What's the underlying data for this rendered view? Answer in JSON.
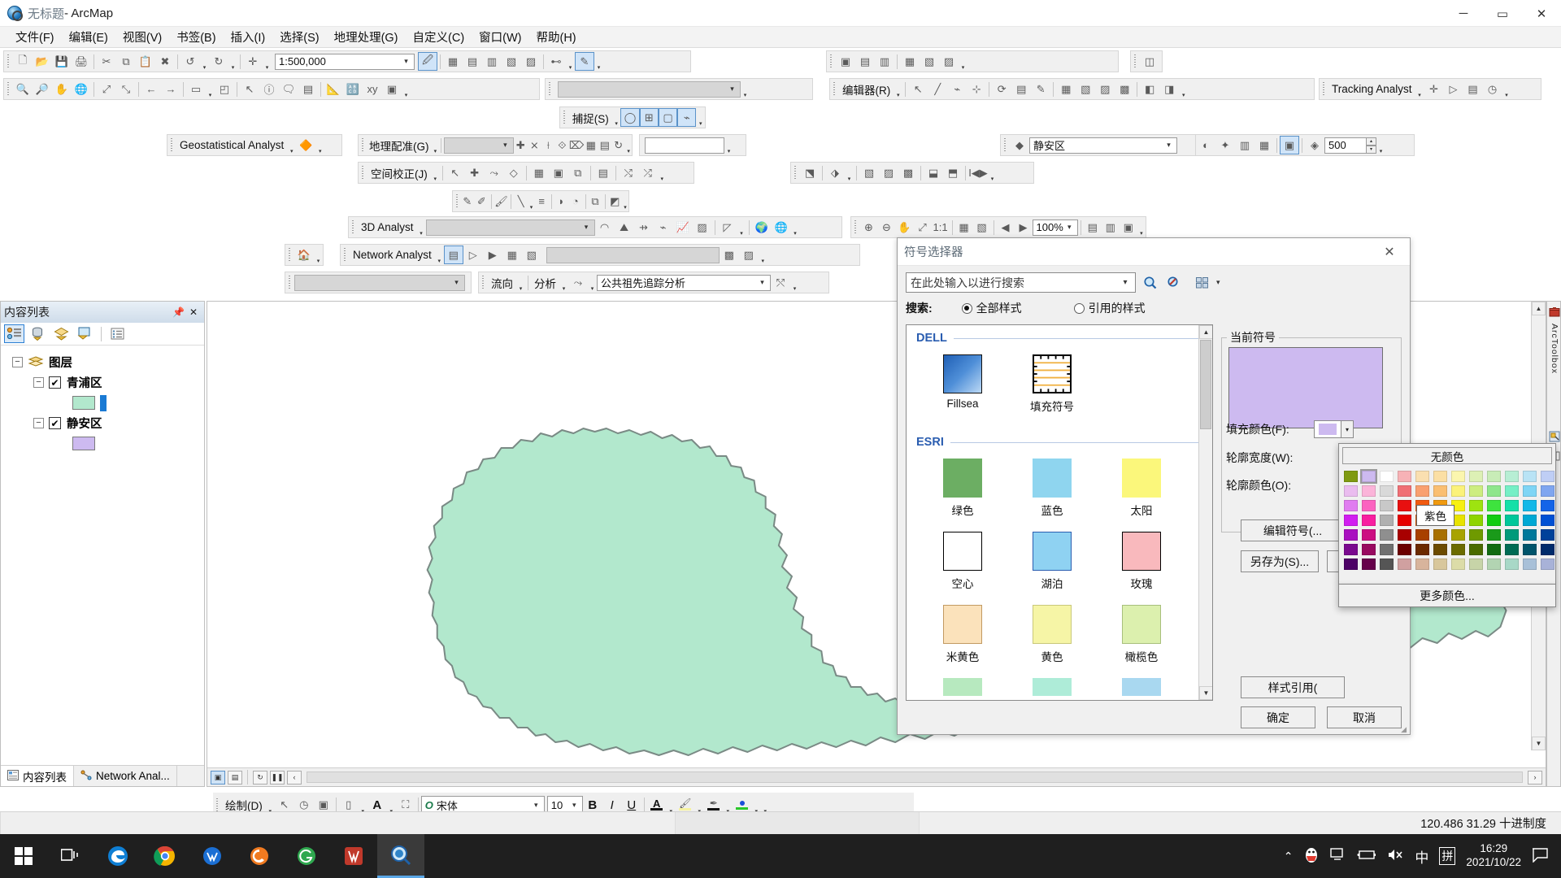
{
  "window": {
    "doc_title": "无标题",
    "app_title": " - ArcMap",
    "minimize": "─",
    "maximize": "▭",
    "close": "✕"
  },
  "menu": [
    {
      "label": "文件(F)"
    },
    {
      "label": "编辑(E)"
    },
    {
      "label": "视图(V)"
    },
    {
      "label": "书签(B)"
    },
    {
      "label": "插入(I)"
    },
    {
      "label": "选择(S)"
    },
    {
      "label": "地理处理(G)"
    },
    {
      "label": "自定义(C)"
    },
    {
      "label": "窗口(W)"
    },
    {
      "label": "帮助(H)"
    }
  ],
  "toolbars": {
    "standard": {
      "scale_value": "1:500,000"
    },
    "snapping": {
      "label": "捕捉(S)"
    },
    "editor": {
      "label": "编辑器(R)"
    },
    "tracking": {
      "label": "Tracking Analyst"
    },
    "geostat": {
      "label": "Geostatistical Analyst"
    },
    "georef": {
      "label": "地理配准(G)",
      "combo_value": ""
    },
    "spatial_adjust": {
      "label": "空间校正(J)"
    },
    "analyst3d": {
      "label": "3D Analyst",
      "combo_value": ""
    },
    "network": {
      "label": "Network Analyst",
      "combo_value": ""
    },
    "utility": {
      "flow": "流向",
      "analysis": "分析",
      "trace_value": "公共祖先追踪分析"
    },
    "layer_select": {
      "value": "静安区"
    },
    "buffer_value": "500",
    "zoom_pct": "100%",
    "draw": {
      "label": "绘制(D)",
      "font": "宋体",
      "size": "10",
      "bold": "B",
      "italic": "I",
      "underline": "U"
    }
  },
  "toc": {
    "title": "内容列表",
    "pin": "📌",
    "close": "✕",
    "root": "图层",
    "layers": [
      {
        "name": "青浦区",
        "fill": "#b2e8cd",
        "checked": true
      },
      {
        "name": "静安区",
        "fill": "#cdbaf0",
        "checked": true
      }
    ],
    "tabs": [
      {
        "label": "内容列表",
        "active": true
      },
      {
        "label": "Network Anal...",
        "active": false
      }
    ]
  },
  "right_dock": [
    {
      "label": "ArcToolbox"
    },
    {
      "label": ""
    }
  ],
  "dialog": {
    "title": "符号选择器",
    "close": "✕",
    "search_placeholder": "在此处输入以进行搜索",
    "search_label": "搜索:",
    "mode_all": "全部样式",
    "mode_referenced": "引用的样式",
    "mode_all_selected": true,
    "groups": [
      {
        "name": "DELL",
        "symbols": [
          {
            "caption": "Fillsea",
            "fill": "#2f6fbf",
            "kind": "gradient"
          },
          {
            "caption": "填充符号",
            "fill": "#ffffff",
            "kind": "hatch"
          }
        ]
      },
      {
        "name": "ESRI",
        "symbols": [
          {
            "caption": "绿色",
            "fill": "#6cae63",
            "kind": "solid",
            "stroke": "#6cae63"
          },
          {
            "caption": "蓝色",
            "fill": "#8fd5ef",
            "kind": "solid",
            "stroke": "#8fd5ef"
          },
          {
            "caption": "太阳",
            "fill": "#fbf77b",
            "kind": "solid",
            "stroke": "#fbf77b"
          },
          {
            "caption": "空心",
            "fill": "#ffffff",
            "kind": "solid",
            "stroke": "#000000"
          },
          {
            "caption": "湖泊",
            "fill": "#8fd2f2",
            "kind": "solid",
            "stroke": "#2a5db0"
          },
          {
            "caption": "玫瑰",
            "fill": "#f9b9bd",
            "kind": "solid",
            "stroke": "#000000"
          },
          {
            "caption": "米黄色",
            "fill": "#fbe2bb",
            "kind": "solid",
            "stroke": "#c29a62"
          },
          {
            "caption": "黄色",
            "fill": "#f6f5a6",
            "kind": "solid",
            "stroke": "#c9c87a"
          },
          {
            "caption": "橄榄色",
            "fill": "#dcf0ae",
            "kind": "solid",
            "stroke": "#a8bf7c"
          },
          {
            "caption": "",
            "fill": "#b7e9bf",
            "kind": "solid",
            "stroke": "#b7e9bf"
          },
          {
            "caption": "",
            "fill": "#aeecd8",
            "kind": "solid",
            "stroke": "#aeecd8"
          },
          {
            "caption": "",
            "fill": "#a9d8f0",
            "kind": "solid",
            "stroke": "#a9d8f0"
          }
        ]
      }
    ],
    "current_symbol_label": "当前符号",
    "current_symbol_fill": "#cdbaf0",
    "fields": {
      "fill_color": "填充颜色(F):",
      "outline_width": "轮廓宽度(W):",
      "outline_color": "轮廓颜色(O):"
    },
    "buttons": {
      "edit_symbol": "编辑符号(...",
      "save_as": "另存为(S)...",
      "style_ref": "样式引用(",
      "ok": "确定",
      "cancel": "取消"
    }
  },
  "color_popup": {
    "no_color": "无颜色",
    "more_colors": "更多颜色...",
    "tooltip": "紫色",
    "selected_index": 13,
    "swatches": [
      "#7f9a11",
      "#cdbaf0",
      "#ffffff",
      "#f7b2b6",
      "#fadfb0",
      "#fbdfa4",
      "#fbf6ae",
      "#ddf0b5",
      "#c8ecb7",
      "#b7eed4",
      "#b9e3f5",
      "#bfcef5",
      "#eabcef",
      "#fbb4d9",
      "#d9d9d9",
      "#f06f75",
      "#f9a070",
      "#fabf72",
      "#fbf27a",
      "#cded80",
      "#8fe68c",
      "#76efc6",
      "#7fd5f5",
      "#7fa6f0",
      "#e07cf0",
      "#fb63c0",
      "#c8c8c8",
      "#e81010",
      "#f25a10",
      "#f09a10",
      "#f7f010",
      "#9ee310",
      "#3ee33e",
      "#14e0a8",
      "#14b8e8",
      "#1464e8",
      "#d11ef0",
      "#f81ea0",
      "#b0b0b0",
      "#e60000",
      "#e35a00",
      "#e39a00",
      "#e8e300",
      "#8fd400",
      "#12cc12",
      "#00c79a",
      "#00a8d4",
      "#0050d4",
      "#a910c0",
      "#cc0e82",
      "#8f8f8f",
      "#a80000",
      "#a84000",
      "#a87000",
      "#a8a300",
      "#6f9a00",
      "#1a9a1a",
      "#009a7a",
      "#00789a",
      "#00419a",
      "#7a0a8f",
      "#990a60",
      "#707070",
      "#6b0000",
      "#6b2a00",
      "#6b4a00",
      "#6b6b00",
      "#4a6b00",
      "#126b12",
      "#006b54",
      "#00546b",
      "#002b6b",
      "#4d0266",
      "#66014a",
      "#555555",
      "#d0a0a0",
      "#d8b49c",
      "#d8c79c",
      "#dcdca8",
      "#c7d4a8",
      "#b2d4b2",
      "#a8d8c7",
      "#a8c0d8",
      "#a8b2d8"
    ]
  },
  "status": {
    "coords": "120.486  31.29 十进制度"
  },
  "taskbar": {
    "clock_time": "16:29",
    "clock_date": "2021/10/22",
    "ime": "中",
    "ime2": "拼"
  }
}
